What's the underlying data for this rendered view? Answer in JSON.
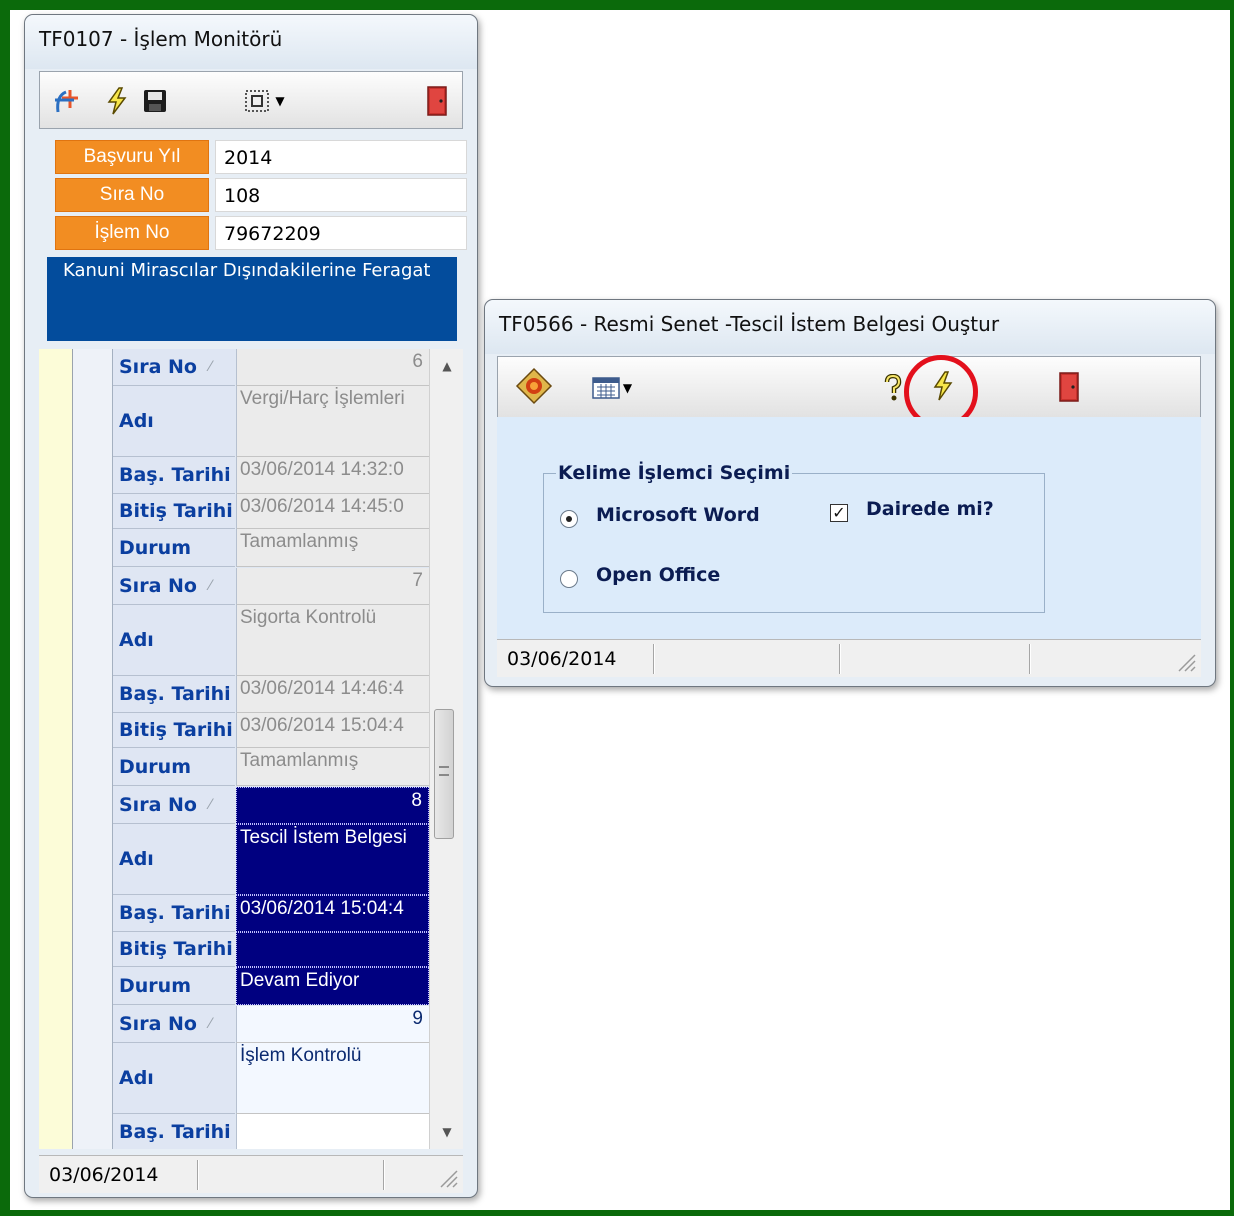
{
  "monitor": {
    "title": "TF0107 - İşlem Monitörü",
    "form": {
      "rows": [
        {
          "label": "Başvuru Yıl",
          "value": "2014"
        },
        {
          "label": "Sıra No",
          "value": "108"
        },
        {
          "label": "İşlem No",
          "value": "79672209"
        }
      ],
      "description": "Kanuni Mirascılar Dışındakilerine Feragat"
    },
    "grid": {
      "field_labels": {
        "sira_no": "Sıra No",
        "adi": "Adı",
        "bas_tarihi": "Baş. Tarihi",
        "bitis_tarihi": "Bitiş Tarihi",
        "durum": "Durum"
      },
      "records": [
        {
          "sira_no": "6",
          "adi": "Vergi/Harç İşlemleri",
          "bas_tarihi": "03/06/2014 14:32:0",
          "bitis_tarihi": "03/06/2014 14:45:0",
          "durum": "Tamamlanmış"
        },
        {
          "sira_no": "7",
          "adi": "Sigorta Kontrolü",
          "bas_tarihi": "03/06/2014 14:46:4",
          "bitis_tarihi": "03/06/2014 15:04:4",
          "durum": "Tamamlanmış"
        },
        {
          "sira_no": "8",
          "adi": "Tescil İstem Belgesi",
          "bas_tarihi": "03/06/2014 15:04:4",
          "bitis_tarihi": "",
          "durum": "Devam Ediyor"
        },
        {
          "sira_no": "9",
          "adi": "İşlem Kontrolü",
          "bas_tarihi": "",
          "bitis_tarihi": "",
          "durum": ""
        }
      ]
    },
    "status_date": "03/06/2014"
  },
  "senet": {
    "title": "TF0566 - Resmi Senet -Tescil İstem Belgesi Ouştur",
    "group_title": "Kelime İşlemci Seçimi",
    "options": [
      "Microsoft Word",
      "Open Office"
    ],
    "selected_option": "Microsoft Word",
    "checkbox_label": "Dairede mi?",
    "checkbox_checked": true,
    "status_date": "03/06/2014"
  },
  "colors": {
    "frame_border": "#0b6a0b",
    "orange_label": "#f28d22",
    "description_bg": "#034c9c",
    "selected_row": "#000080",
    "highlight_circle": "#e3101c"
  },
  "icons": [
    "logo-icon",
    "lightning-icon",
    "save-icon",
    "layout-icon",
    "exit-door-icon",
    "chart-icon",
    "calendar-icon",
    "help-icon"
  ]
}
